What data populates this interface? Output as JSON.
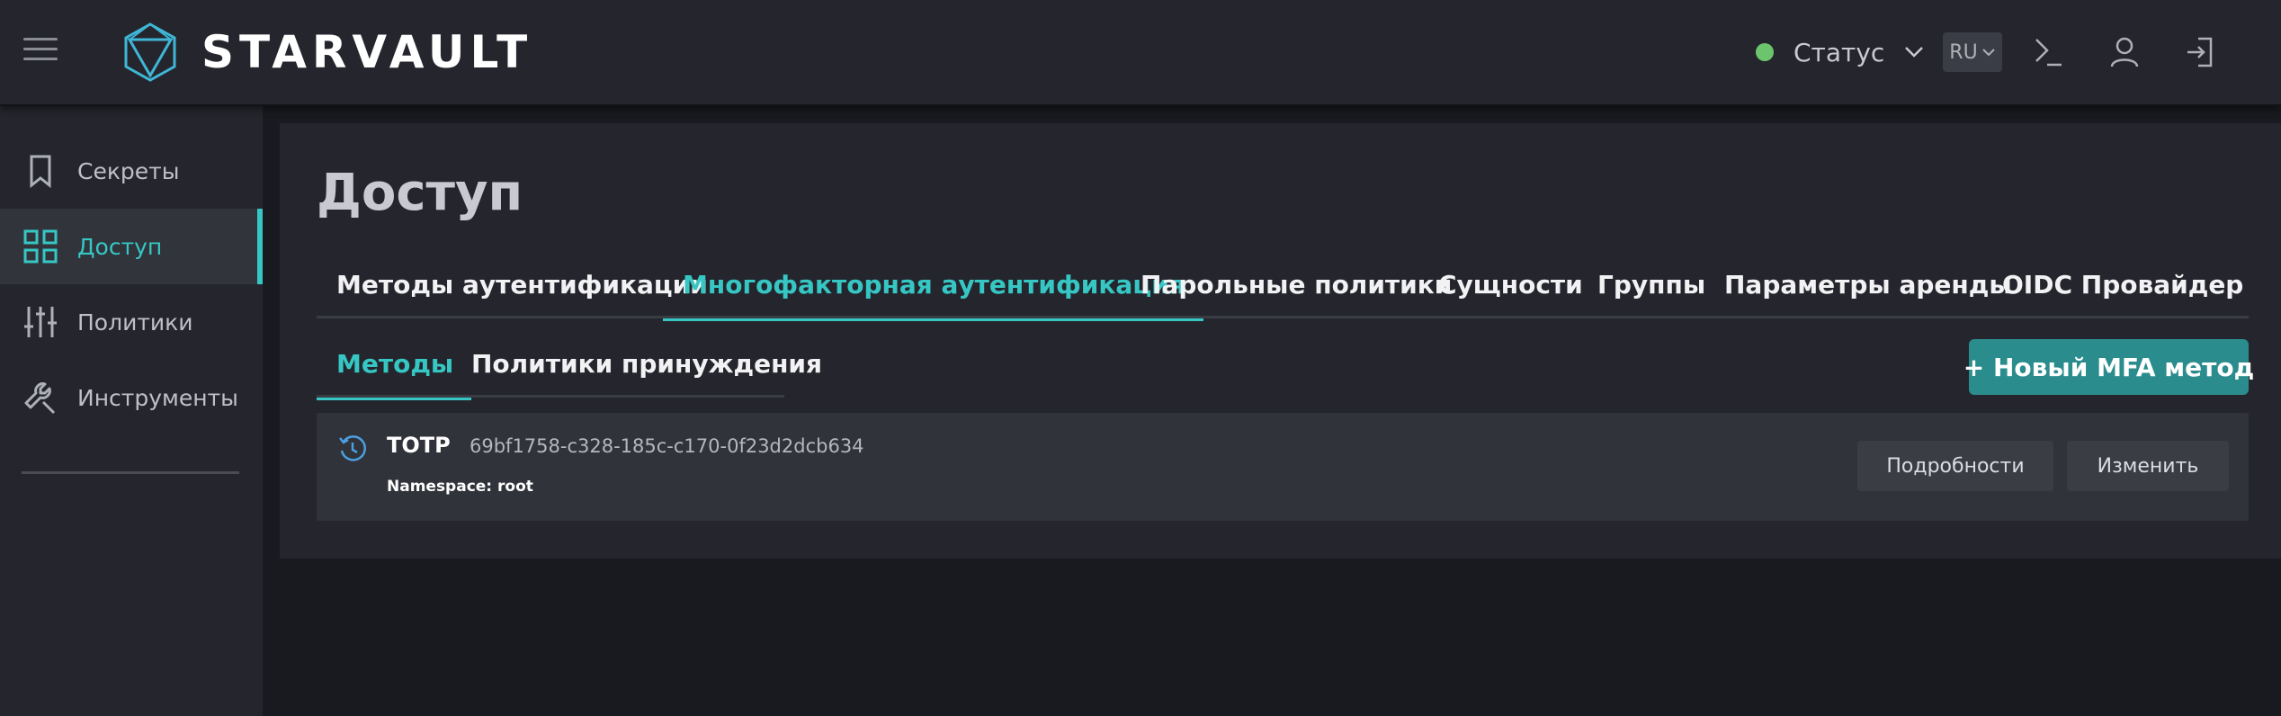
{
  "header": {
    "logo_text": "STARVAULT",
    "status_label": "Статус",
    "status_color": "#6cc56c",
    "lang": "RU",
    "icons": [
      "menu-icon",
      "logo-icon",
      "chevron-down-icon",
      "terminal-icon",
      "user-icon",
      "logout-icon"
    ]
  },
  "sidebar": {
    "items": [
      {
        "label": "Секреты",
        "icon": "bookmark-icon"
      },
      {
        "label": "Доступ",
        "icon": "grid-icon",
        "active": true
      },
      {
        "label": "Политики",
        "icon": "sliders-icon"
      },
      {
        "label": "Инструменты",
        "icon": "wrench-icon"
      }
    ]
  },
  "main": {
    "title": "Доступ",
    "tabs": [
      {
        "label": "Методы аутентификации"
      },
      {
        "label": "Многофакторная аутентификация",
        "active": true
      },
      {
        "label": "Парольные политики"
      },
      {
        "label": "Сущности"
      },
      {
        "label": "Группы"
      },
      {
        "label": "Параметры аренды"
      },
      {
        "label": "OIDC Провайдер"
      }
    ],
    "subtabs": [
      {
        "label": "Методы",
        "active": true
      },
      {
        "label": "Политики принуждения"
      }
    ],
    "new_button": "+ Новый MFA метод",
    "methods": [
      {
        "type": "TOTP",
        "id": "69bf1758-c328-185c-c170-0f23d2dcb634",
        "namespace": "Namespace: root",
        "details_label": "Подробности",
        "edit_label": "Изменить"
      }
    ]
  },
  "colors": {
    "accent": "#36c7c4",
    "button_primary": "#2b8c8e",
    "background": "#191a1f",
    "panel": "#25262d"
  }
}
